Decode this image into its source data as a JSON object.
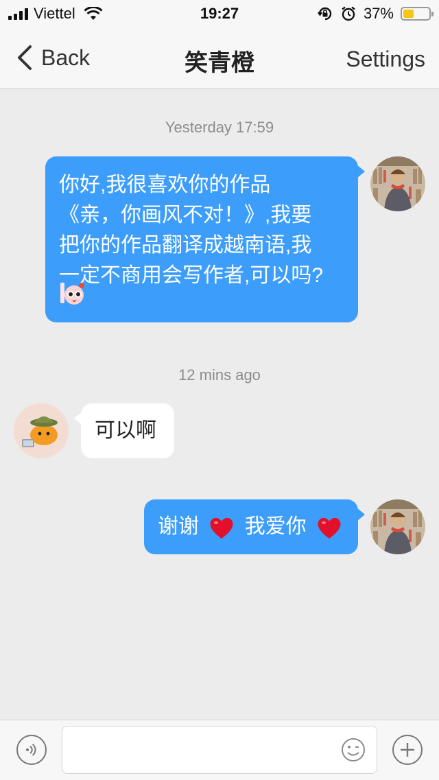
{
  "status_bar": {
    "carrier": "Viettel",
    "time": "19:27",
    "battery_percent": "37%",
    "battery_level": 0.37
  },
  "nav": {
    "back_label": "Back",
    "title": "笑青橙",
    "settings_label": "Settings"
  },
  "messages": [
    {
      "timestamp": "Yesterday 17:59"
    },
    {
      "direction": "outgoing",
      "lines": [
        "你好,我很喜欢你的作品",
        "《亲，你画风不对！》,我要",
        "把你的作品翻译成越南语,我",
        "一定不商用会写作者,可以吗?"
      ],
      "sticker": "cute-face-sticker"
    },
    {
      "timestamp": "12 mins ago"
    },
    {
      "direction": "incoming",
      "text": "可以啊"
    },
    {
      "direction": "outgoing",
      "text_part1": "谢谢",
      "text_part2": "我爱你",
      "emoji": "red-heart"
    }
  ],
  "composer": {
    "placeholder": "",
    "icons": [
      "voice-icon",
      "emoji-icon",
      "plus-icon"
    ]
  },
  "colors": {
    "outgoing_bubble": "#3d9dfb",
    "incoming_bubble": "#ffffff",
    "background": "#ececec",
    "heart": "#e3102c"
  }
}
